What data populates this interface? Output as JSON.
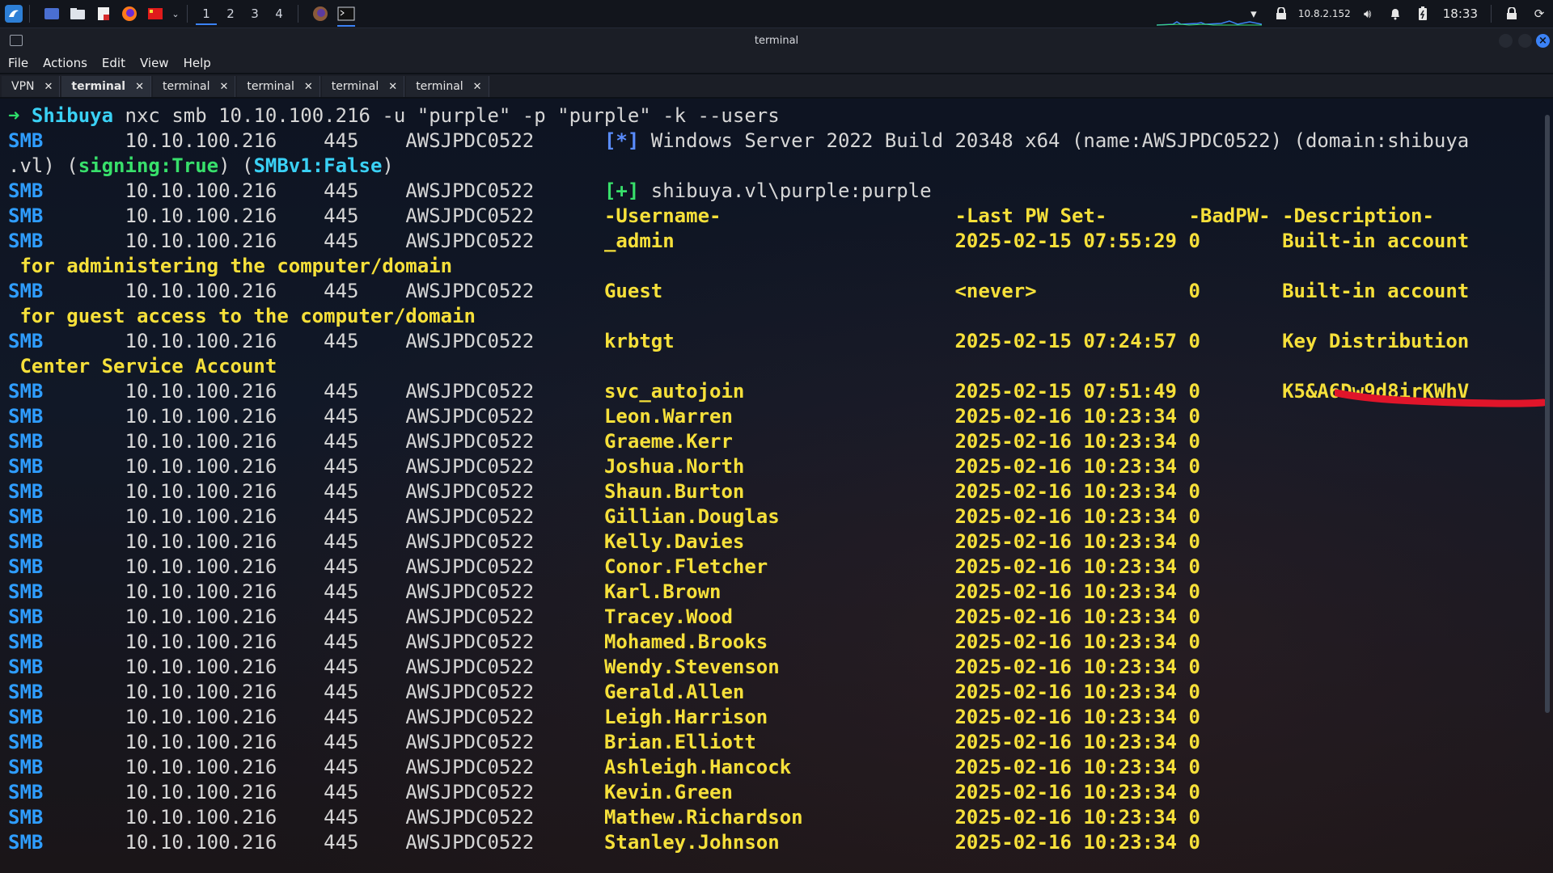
{
  "taskbar": {
    "workspaces": [
      "1",
      "2",
      "3",
      "4"
    ],
    "ip": "10.8.2.152",
    "clock": "18:33"
  },
  "window": {
    "title": "terminal",
    "menu": [
      "File",
      "Actions",
      "Edit",
      "View",
      "Help"
    ],
    "tabs": [
      {
        "label": "VPN",
        "active": false
      },
      {
        "label": "terminal",
        "active": true
      },
      {
        "label": "terminal",
        "active": false
      },
      {
        "label": "terminal",
        "active": false
      },
      {
        "label": "terminal",
        "active": false
      },
      {
        "label": "terminal",
        "active": false
      }
    ]
  },
  "terminal": {
    "prompt_arrow": "➜",
    "prompt_host": "Shibuya",
    "command": "nxc smb 10.10.100.216 -u \"purple\" -p \"purple\" -k --users",
    "smb_label": "SMB",
    "ip": "10.10.100.216",
    "port": "445",
    "host": "AWSJPDC0522",
    "info_marker": "[*]",
    "info_text": "Windows Server 2022 Build 20348 x64 (name:AWSJPDC0522) (domain:shibuya",
    "info_cont_prefix": ".vl) (",
    "signing": "signing:True",
    "mid": ") (",
    "smbv1": "SMBv1:False",
    "info_cont_suffix": ")",
    "auth_marker": "[+]",
    "auth_text": "shibuya.vl\\purple:purple",
    "headers": {
      "username": "-Username-",
      "lastpw": "-Last PW Set-",
      "badpw": "-BadPW-",
      "desc": "-Description-"
    },
    "users": [
      {
        "name": "_admin",
        "lastpw": "2025-02-15 07:55:29",
        "badpw": "0",
        "desc": "Built-in account",
        "wrap": " for administering the computer/domain"
      },
      {
        "name": "Guest",
        "lastpw": "<never>",
        "badpw": "0",
        "desc": "Built-in account",
        "wrap": " for guest access to the computer/domain"
      },
      {
        "name": "krbtgt",
        "lastpw": "2025-02-15 07:24:57",
        "badpw": "0",
        "desc": "Key Distribution",
        "wrap": " Center Service Account"
      },
      {
        "name": "svc_autojoin",
        "lastpw": "2025-02-15 07:51:49",
        "badpw": "0",
        "desc": "K5&A6Dw9d8irKWhV",
        "wrap": ""
      },
      {
        "name": "Leon.Warren",
        "lastpw": "2025-02-16 10:23:34",
        "badpw": "0",
        "desc": "",
        "wrap": ""
      },
      {
        "name": "Graeme.Kerr",
        "lastpw": "2025-02-16 10:23:34",
        "badpw": "0",
        "desc": "",
        "wrap": ""
      },
      {
        "name": "Joshua.North",
        "lastpw": "2025-02-16 10:23:34",
        "badpw": "0",
        "desc": "",
        "wrap": ""
      },
      {
        "name": "Shaun.Burton",
        "lastpw": "2025-02-16 10:23:34",
        "badpw": "0",
        "desc": "",
        "wrap": ""
      },
      {
        "name": "Gillian.Douglas",
        "lastpw": "2025-02-16 10:23:34",
        "badpw": "0",
        "desc": "",
        "wrap": ""
      },
      {
        "name": "Kelly.Davies",
        "lastpw": "2025-02-16 10:23:34",
        "badpw": "0",
        "desc": "",
        "wrap": ""
      },
      {
        "name": "Conor.Fletcher",
        "lastpw": "2025-02-16 10:23:34",
        "badpw": "0",
        "desc": "",
        "wrap": ""
      },
      {
        "name": "Karl.Brown",
        "lastpw": "2025-02-16 10:23:34",
        "badpw": "0",
        "desc": "",
        "wrap": ""
      },
      {
        "name": "Tracey.Wood",
        "lastpw": "2025-02-16 10:23:34",
        "badpw": "0",
        "desc": "",
        "wrap": ""
      },
      {
        "name": "Mohamed.Brooks",
        "lastpw": "2025-02-16 10:23:34",
        "badpw": "0",
        "desc": "",
        "wrap": ""
      },
      {
        "name": "Wendy.Stevenson",
        "lastpw": "2025-02-16 10:23:34",
        "badpw": "0",
        "desc": "",
        "wrap": ""
      },
      {
        "name": "Gerald.Allen",
        "lastpw": "2025-02-16 10:23:34",
        "badpw": "0",
        "desc": "",
        "wrap": ""
      },
      {
        "name": "Leigh.Harrison",
        "lastpw": "2025-02-16 10:23:34",
        "badpw": "0",
        "desc": "",
        "wrap": ""
      },
      {
        "name": "Brian.Elliott",
        "lastpw": "2025-02-16 10:23:34",
        "badpw": "0",
        "desc": "",
        "wrap": ""
      },
      {
        "name": "Ashleigh.Hancock",
        "lastpw": "2025-02-16 10:23:34",
        "badpw": "0",
        "desc": "",
        "wrap": ""
      },
      {
        "name": "Kevin.Green",
        "lastpw": "2025-02-16 10:23:34",
        "badpw": "0",
        "desc": "",
        "wrap": ""
      },
      {
        "name": "Mathew.Richardson",
        "lastpw": "2025-02-16 10:23:34",
        "badpw": "0",
        "desc": "",
        "wrap": ""
      },
      {
        "name": "Stanley.Johnson",
        "lastpw": "2025-02-16 10:23:34",
        "badpw": "0",
        "desc": "",
        "wrap": ""
      }
    ]
  },
  "colors": {
    "smb": "#2f9dff",
    "user": "#f6e03a",
    "ok": "#38e06b",
    "host": "#3ad1f5",
    "redaction": "#e0152a"
  }
}
